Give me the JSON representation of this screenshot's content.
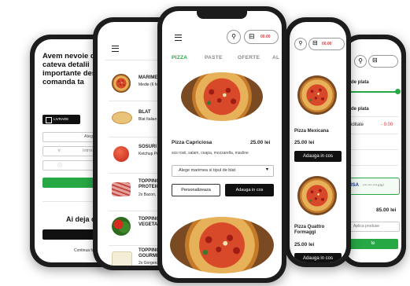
{
  "phone1": {
    "intro": "Avem nevoie de cateva detalii importante despre comanda ta",
    "store_badge": "LIVRARE",
    "age_field": "Alege O",
    "phone_field": "Introdu Ce",
    "verify_button": "Verifica Ad",
    "account_prompt": "Ai deja c",
    "login_button": "Autentific",
    "guest_link": "Continua fa"
  },
  "phone2": {
    "steps": [
      {
        "title": "MARIME",
        "sub": "Medie (6 fe"
      },
      {
        "title": "BLAT",
        "sub": "Blat Italian"
      },
      {
        "title": "SOSURI",
        "sub": "Ketchup Pu Salsa"
      },
      {
        "title": "TOPPING PROTEIC",
        "sub": "2x Bacon, 2"
      },
      {
        "title": "TOPPING VEGETAL",
        "sub": ""
      },
      {
        "title": "TOPPING GOURMET",
        "sub": "2x Gorgonz"
      }
    ]
  },
  "phone3": {
    "cart_total": "00.00",
    "tabs": [
      "PIZZA",
      "PASTE",
      "OFERTE",
      "AL"
    ],
    "product": {
      "name": "Pizza Capriciosa",
      "price": "25.00 lei",
      "desc": "sos rosii, salam, ceapa, mozzarella, masline"
    },
    "size_select": "Alege marimea si tipul de blat",
    "customize_button": "Personalizeaza",
    "add_button": "Adauga in cos"
  },
  "phone4": {
    "cart_total": "00.00",
    "products": [
      {
        "name": "Pizza Mexicana",
        "price": "25.00 lei",
        "button": "Adauga in cos"
      },
      {
        "name": "Pizza Quattro Formaggi",
        "price": "25.00 lei",
        "button": "Adauga in cos"
      }
    ]
  },
  "phone5": {
    "label1": "de plata",
    "label2": "de plata",
    "label3": "iditate",
    "discount": "- 0.00",
    "card_brand": "ISA",
    "card_number": "**** **** **** 6767",
    "total": "85.00 lei",
    "promo_placeholder": "Aplica produse",
    "pay_button": "te"
  },
  "colors": {
    "accent": "#27a844",
    "price_red": "#e0353b",
    "dark": "#111111"
  }
}
